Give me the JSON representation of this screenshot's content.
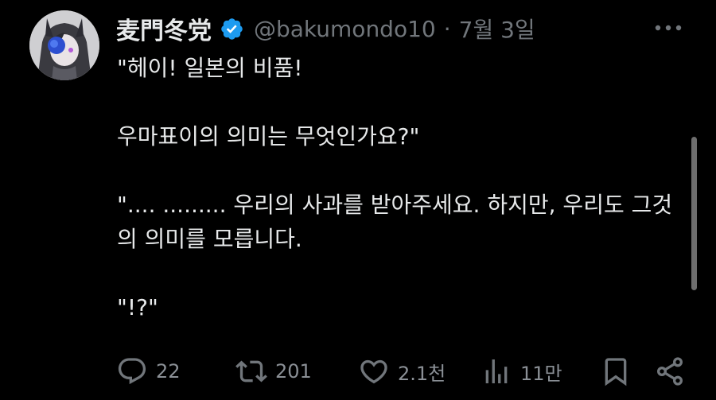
{
  "tweet": {
    "display_name": "麦門冬党",
    "handle": "@bakumondo10",
    "separator": "·",
    "date": "7월 3일",
    "paragraphs": [
      "\"헤이! 일본의 비품!",
      "우마표이의 의미는 무엇인가요?\"",
      "\".... ......... 우리의 사과를 받아주세요. 하지만, 우리도 그것\n의 의미를 모릅니다.",
      "\"!?\""
    ]
  },
  "actions": {
    "reply_count": "22",
    "retweet_count": "201",
    "like_count": "2.1천",
    "views_count": "11만"
  },
  "icons": {
    "verified": "verified-badge-icon",
    "more": "more-options-icon",
    "reply": "reply-icon",
    "retweet": "retweet-icon",
    "like": "heart-icon",
    "views": "views-icon",
    "bookmark": "bookmark-icon",
    "share": "share-icon"
  },
  "colors": {
    "background": "#000000",
    "text": "#e7e9ea",
    "secondary": "#71767b",
    "verified": "#1d9bf0"
  }
}
